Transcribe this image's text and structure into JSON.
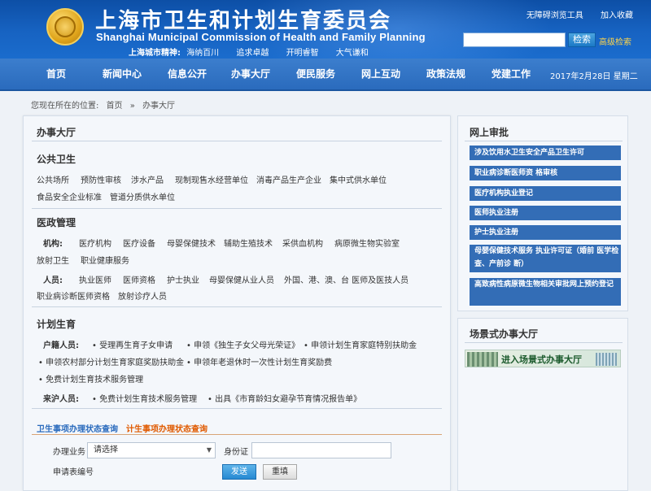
{
  "header": {
    "title_cn": "上海市卫生和计划生育委员会",
    "title_en": "Shanghai Municipal Commission of Health and Family Planning",
    "spirit_label": "上海城市精神:",
    "spirit_items": [
      "海纳百川",
      "追求卓越",
      "开明睿智",
      "大气谦和"
    ],
    "top_links": [
      "无障碍浏览工具",
      "加入收藏"
    ],
    "search_button": "检索",
    "advanced_search": "高级检索"
  },
  "nav": {
    "items": [
      "首页",
      "新闻中心",
      "信息公开",
      "办事大厅",
      "便民服务",
      "网上互动",
      "政策法规",
      "党建工作"
    ],
    "date": "2017年2月28日 星期二"
  },
  "breadcrumb": {
    "label": "您现在所在的位置:",
    "items": [
      "首页",
      "»",
      "办事大厅"
    ]
  },
  "main": {
    "title": "办事大厅",
    "public_health": {
      "title": "公共卫生",
      "row1": [
        "公共场所",
        "预防性审核",
        "涉水产品",
        "现制现售水经营单位",
        "消毒产品生产企业",
        "集中式供水单位"
      ],
      "row2": [
        "食品安全企业标准",
        "管道分质供水单位"
      ]
    },
    "medical": {
      "title": "医政管理",
      "org_label": "机构:",
      "org_row1": [
        "医疗机构",
        "医疗设备",
        "母婴保健技术",
        "辅助生殖技术",
        "采供血机构",
        "病原微生物实验室"
      ],
      "org_row2": [
        "放射卫生",
        "职业健康服务"
      ],
      "person_label": "人员:",
      "person_row1": [
        "执业医师",
        "医师资格",
        "护士执业",
        "母婴保健从业人员",
        "外国、港、澳、台 医师及医技人员"
      ],
      "person_row2": [
        "职业病诊断医师资格",
        "放射诊疗人员"
      ]
    },
    "family_planning": {
      "title": "计划生育",
      "resident_label": "户籍人员:",
      "resident_row1": [
        "• 受理再生育子女申请",
        "• 申领《独生子女父母光荣证》",
        "• 申领计划生育家庭特别扶助金"
      ],
      "resident_row2": [
        "• 申领农村部分计划生育家庭奖励扶助金",
        "• 申领年老退休时一次性计划生育奖励费"
      ],
      "resident_row3": [
        "• 免费计划生育技术服务管理"
      ],
      "migrant_label": "来沪人员:",
      "migrant_row1": [
        "• 免费计划生育技术服务管理",
        "• 出具《市育龄妇女避孕节育情况报告单》"
      ]
    },
    "query": {
      "tab1": "卫生事项办理状态查询",
      "tab2": "计生事项办理状态查询",
      "business_label": "办理业务",
      "select_value": "请选择",
      "idcard_label": "身份证",
      "form_no_label": "申请表编号",
      "submit": "发送",
      "reset": "重填"
    }
  },
  "sidebar": {
    "online_title": "网上审批",
    "online_items": [
      "涉及饮用水卫生安全产品卫生许可",
      "职业病诊断医师资 格审核",
      "医疗机构执业登记",
      "医师执业注册",
      "护士执业注册",
      "母婴保健技术服务 执业许可证（婚前 医学检查、产前诊 断）",
      "高致病性病原微生物相关审批网上预约登记"
    ],
    "scene_title": "场景式办事大厅",
    "scene_banner": "进入场景式办事大厅"
  }
}
